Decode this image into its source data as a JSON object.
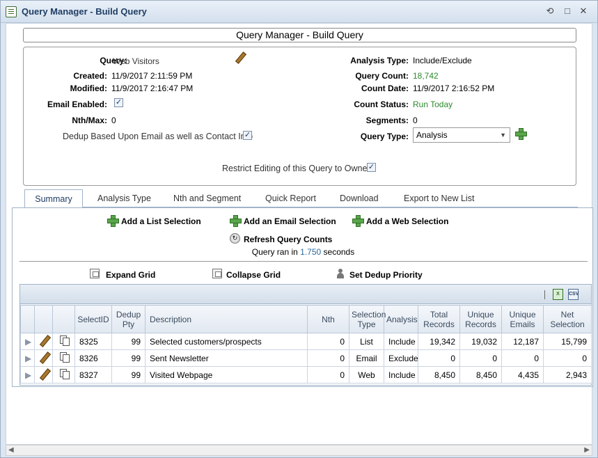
{
  "window": {
    "title": "Query Manager - Build Query",
    "controls": [
      "restore-icon",
      "maximize-icon",
      "close-icon"
    ]
  },
  "header": {
    "title": "Query Manager - Build Query"
  },
  "info": {
    "query_label": "Query:",
    "query_value": "Web Visitors",
    "created_label": "Created:",
    "created_value": "11/9/2017 2:11:59 PM",
    "modified_label": "Modified:",
    "modified_value": "11/9/2017 2:16:47 PM",
    "email_enabled_label": "Email Enabled:",
    "email_enabled": true,
    "nthmax_label": "Nth/Max:",
    "nthmax_value": "0",
    "dedup_label": "Dedup Based Upon Email as well as Contact Info",
    "dedup_checked": true,
    "analysis_type_label": "Analysis Type:",
    "analysis_type_value": "Include/Exclude",
    "query_count_label": "Query Count:",
    "query_count_value": "18,742",
    "count_date_label": "Count Date:",
    "count_date_value": "11/9/2017 2:16:52 PM",
    "count_status_label": "Count Status:",
    "count_status_value": "Run Today",
    "segments_label": "Segments:",
    "segments_value": "0",
    "query_type_label": "Query Type:",
    "query_type_value": "Analysis",
    "restrict_label": "Restrict Editing of this Query to Owner",
    "restrict_checked": true
  },
  "tabs": [
    "Summary",
    "Analysis Type",
    "Nth and Segment",
    "Quick Report",
    "Download",
    "Export to New List"
  ],
  "actions": {
    "add_list": "Add a List Selection",
    "add_email": "Add an Email Selection",
    "add_web": "Add a Web Selection",
    "refresh": "Refresh Query Counts",
    "ran_prefix": "Query ran in ",
    "ran_time": "1.750",
    "ran_suffix": " seconds",
    "expand": "Expand Grid",
    "collapse": "Collapse Grid",
    "dedup_priority": "Set Dedup Priority"
  },
  "grid": {
    "toolbar": {
      "excel_icon": "excel-export-icon",
      "csv_icon": "csv-export-icon",
      "csv_text": "CSV"
    },
    "headers": {
      "selectid": "SelectID",
      "dedup1": "Dedup",
      "dedup2": "Pty",
      "description": "Description",
      "nth": "Nth",
      "seltype1": "Selection",
      "seltype2": "Type",
      "analysis": "Analysis",
      "total1": "Total",
      "total2": "Records",
      "unique1": "Unique",
      "unique2": "Records",
      "uemails1": "Unique",
      "uemails2": "Emails",
      "net1": "Net",
      "net2": "Selection"
    },
    "rows": [
      {
        "selectid": "8325",
        "dedup": "99",
        "description": "Selected customers/prospects",
        "nth": "0",
        "type": "List",
        "analysis": "Include",
        "total": "19,342",
        "unique": "19,032",
        "uemails": "12,187",
        "net": "15,799"
      },
      {
        "selectid": "8326",
        "dedup": "99",
        "description": "Sent Newsletter",
        "nth": "0",
        "type": "Email",
        "analysis": "Exclude",
        "total": "0",
        "unique": "0",
        "uemails": "0",
        "net": "0"
      },
      {
        "selectid": "8327",
        "dedup": "99",
        "description": "Visited Webpage",
        "nth": "0",
        "type": "Web",
        "analysis": "Include",
        "total": "8,450",
        "unique": "8,450",
        "uemails": "4,435",
        "net": "2,943"
      }
    ]
  },
  "colors": {
    "accent": "#1f3d63",
    "green_text": "#2c8a2c",
    "plus_green": "#5aa64b"
  }
}
